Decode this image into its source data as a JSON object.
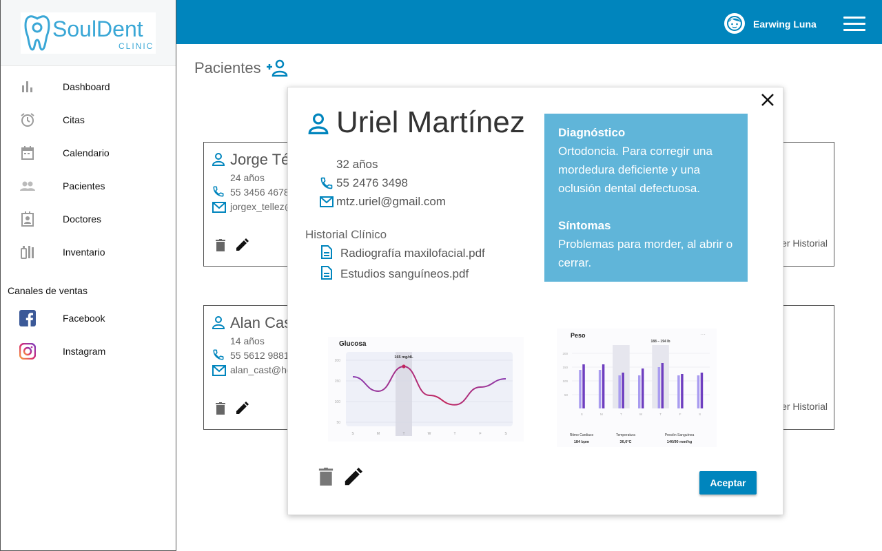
{
  "brand": {
    "logo_text_main": "SoulDent",
    "logo_text_sub": "CLINIC",
    "accent": "#0085bd",
    "panel": "#60b5d9"
  },
  "sidebar": {
    "items": [
      {
        "label": "Dashboard",
        "icon": "bar-chart-icon"
      },
      {
        "label": "Citas",
        "icon": "alarm-clock-icon"
      },
      {
        "label": "Calendario",
        "icon": "calendar-icon"
      },
      {
        "label": "Pacientes",
        "icon": "people-icon"
      },
      {
        "label": "Doctores",
        "icon": "contact-card-icon"
      },
      {
        "label": "Inventario",
        "icon": "dental-tools-icon"
      }
    ],
    "sales_title": "Canales de ventas",
    "sales_items": [
      {
        "label": "Facebook",
        "icon": "facebook-icon"
      },
      {
        "label": "Instagram",
        "icon": "instagram-icon"
      }
    ]
  },
  "topbar": {
    "user_name": "Earwing Luna"
  },
  "page": {
    "title": "Pacientes"
  },
  "cards": [
    {
      "name": "Jorge Tél",
      "age": "24 años",
      "phone": "55 3456 4678",
      "email": "jorgex_tellez@",
      "history": "Ver Historial"
    },
    {
      "name": "Alan Cas",
      "age": "14 años",
      "phone": "55 5612 9881",
      "email": "alan_cast@ho",
      "history": "Ver Historial"
    }
  ],
  "modal": {
    "name": "Uriel Martínez",
    "age": "32 años",
    "phone": "55 2476 3498",
    "email": "mtz.uriel@gmail.com",
    "history_title": "Historial Clínico",
    "files": [
      "Radiografía maxilofacial.pdf",
      "Estudios sanguíneos.pdf"
    ],
    "diagnosis_title": "Diagnóstico",
    "diagnosis_text": "Ortodoncia. Para corregir una mordedura deficiente y una oclusión dental defectuosa.",
    "symptoms_title": "Síntomas",
    "symptoms_text": "Problemas para morder, al abrir o cerrar.",
    "accept_label": "Aceptar"
  },
  "chart_data": [
    {
      "type": "line",
      "title": "Glucosa",
      "categories": [
        "S",
        "M",
        "T",
        "W",
        "T",
        "F",
        "S"
      ],
      "values": [
        160,
        125,
        185,
        115,
        92,
        135,
        155
      ],
      "highlight_index": 2,
      "annotation": "165 mg/dL",
      "yticks": [
        200,
        150,
        100,
        50
      ],
      "ylim": [
        40,
        220
      ]
    },
    {
      "type": "bar",
      "title": "Peso",
      "categories": [
        "S",
        "M",
        "T",
        "W",
        "T",
        "F",
        "S"
      ],
      "series": [
        {
          "values": [
            140,
            140,
            120,
            120,
            150,
            120,
            120
          ]
        },
        {
          "values": [
            160,
            160,
            130,
            145,
            165,
            125,
            130
          ]
        }
      ],
      "highlight_index": 4,
      "annotation": "188 – 194 lb",
      "yticks": [
        200,
        150,
        100,
        50
      ],
      "ylim": [
        0,
        220
      ],
      "footer": [
        {
          "label": "Ritmo Cardiaco",
          "value": "184 bpm"
        },
        {
          "label": "Temperatura",
          "value": "36,6°C"
        },
        {
          "label": "Presión Sanguínea",
          "value": "140/90 mm/hg"
        }
      ]
    }
  ]
}
